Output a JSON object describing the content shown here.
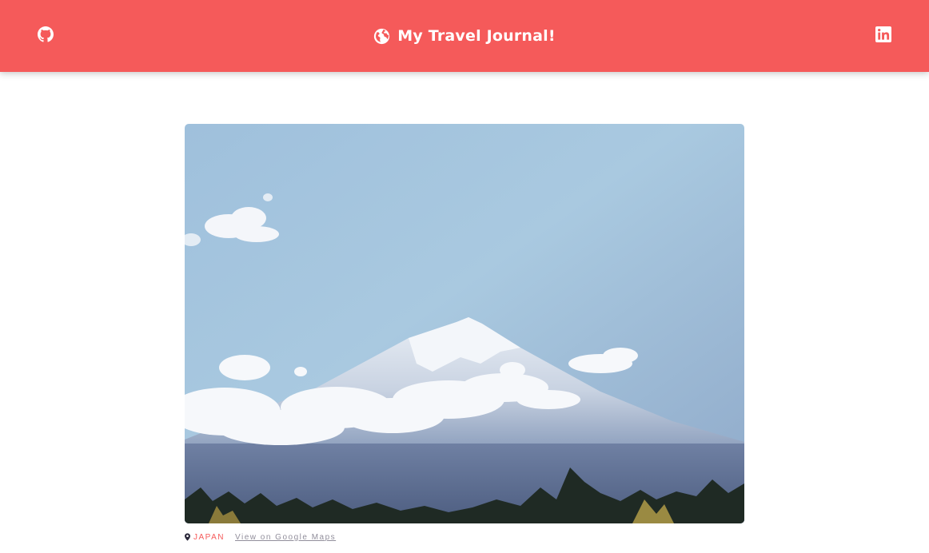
{
  "header": {
    "title": "My Travel Journal!",
    "brand_icon": "globe-icon",
    "left_icon": "github-icon",
    "right_icon": "linkedin-icon",
    "background": "#F55A5A"
  },
  "entry": {
    "image": "mount-fuji-photo",
    "country": "JAPAN",
    "maps_link": "View on Google Maps",
    "location_icon": "location-pin-icon",
    "accent": "#F55A5A",
    "link_color": "#918E9B"
  }
}
